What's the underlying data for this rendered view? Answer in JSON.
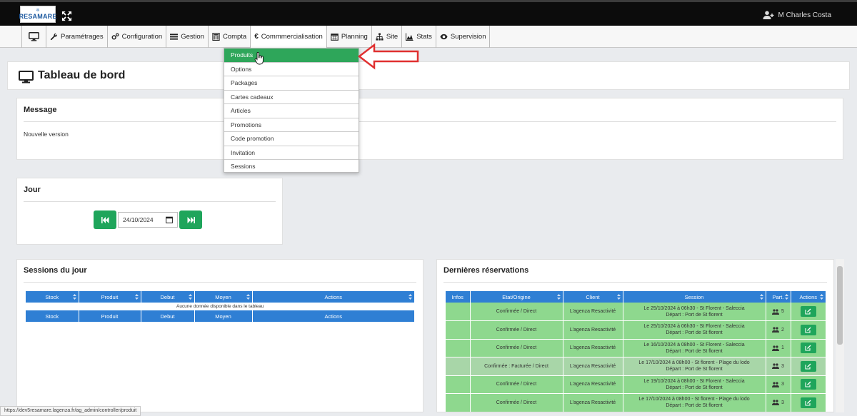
{
  "app": {
    "logo_text": "RESAMARE",
    "logo_sub": "✻"
  },
  "user": {
    "name": "M Charles Costa"
  },
  "menu": [
    {
      "label": ""
    },
    {
      "label": "Paramétrages"
    },
    {
      "label": "Configuration"
    },
    {
      "label": "Gestion"
    },
    {
      "label": "Compta"
    },
    {
      "label": "Commmercialisation"
    },
    {
      "label": "Planning"
    },
    {
      "label": "Site"
    },
    {
      "label": "Stats"
    },
    {
      "label": "Supervision"
    }
  ],
  "dropdown": [
    {
      "label": "Produits"
    },
    {
      "label": "Options"
    },
    {
      "label": "Packages"
    },
    {
      "label": "Cartes cadeaux"
    },
    {
      "label": "Articles"
    },
    {
      "label": "Promotions"
    },
    {
      "label": "Code promotion"
    },
    {
      "label": "Invitation"
    },
    {
      "label": "Sessions"
    }
  ],
  "page": {
    "title": "Tableau de bord"
  },
  "message": {
    "title": "Message",
    "text": "Nouvelle version"
  },
  "jour": {
    "title": "Jour",
    "date": "24/10/2024"
  },
  "sessions": {
    "title": "Sessions du jour",
    "columns": [
      "Stock",
      "Produit",
      "Debut",
      "Moyen",
      "Actions"
    ],
    "empty_text": "Aucune donnée disponible dans le tableau"
  },
  "reservations": {
    "title": "Dernières réservations",
    "columns": [
      "Infos",
      "Etat/Origine",
      "Client",
      "Session",
      "Part.",
      "Actions"
    ],
    "rows": [
      {
        "etat": "Confirmée / Direct",
        "client": "L'agenza Resactivité",
        "session_line1": "Le 25/10/2024 à 06h30 - St Florent - Saleccia",
        "session_line2": "Départ : Port de St florent",
        "part": "5"
      },
      {
        "etat": "Confirmée / Direct",
        "client": "L'agenza Resactivité",
        "session_line1": "Le 25/10/2024 à 06h30 - St Florent - Saleccia",
        "session_line2": "Départ : Port de St florent",
        "part": "2"
      },
      {
        "etat": "Confirmée / Direct",
        "client": "L'agenza Resactivité",
        "session_line1": "Le 16/10/2024 à 08h00 - St Florent - Saleccia",
        "session_line2": "Départ : Port de St florent",
        "part": "1"
      },
      {
        "etat": "Confirmée : Facturée / Direct",
        "client": "L'agenza Resactivité",
        "session_line1": "Le 17/10/2024 à 08h00 - St florent - Plage du lodo",
        "session_line2": "Départ : Port de St florent",
        "part": "3"
      },
      {
        "etat": "Confirmée / Direct",
        "client": "L'agenza Resactivité",
        "session_line1": "Le 19/10/2024 à 08h00 - St Florent - Saleccia",
        "session_line2": "Départ : Port de St florent",
        "part": "3"
      },
      {
        "etat": "Confirmée / Direct",
        "client": "L'agenza Resactivité",
        "session_line1": "Le 17/10/2024 à 08h00 - St florent - Plage du lodo",
        "session_line2": "Départ : Port de St florent",
        "part": "3"
      }
    ]
  },
  "status_url": "https://dev5resamare.lagenza.fr/ag_admin/controller/produit",
  "colors": {
    "green": "#1fa55b",
    "blue_header": "#2f7fd4",
    "row_green": "#8ed88e",
    "arrow_red": "#e03030"
  }
}
